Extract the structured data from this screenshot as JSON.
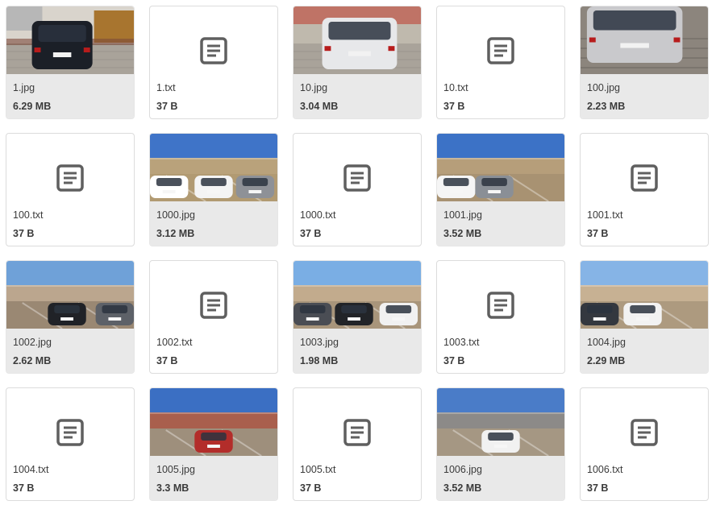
{
  "files": [
    {
      "name": "1.jpg",
      "size": "6.29 MB",
      "type": "image",
      "icon": "car-photo"
    },
    {
      "name": "1.txt",
      "size": "37 B",
      "type": "text",
      "icon": "text-file-icon"
    },
    {
      "name": "10.jpg",
      "size": "3.04 MB",
      "type": "image",
      "icon": "car-photo"
    },
    {
      "name": "10.txt",
      "size": "37 B",
      "type": "text",
      "icon": "text-file-icon"
    },
    {
      "name": "100.jpg",
      "size": "2.23 MB",
      "type": "image",
      "icon": "car-photo"
    },
    {
      "name": "100.txt",
      "size": "37 B",
      "type": "text",
      "icon": "text-file-icon"
    },
    {
      "name": "1000.jpg",
      "size": "3.12 MB",
      "type": "image",
      "icon": "parking-lot-photo"
    },
    {
      "name": "1000.txt",
      "size": "37 B",
      "type": "text",
      "icon": "text-file-icon"
    },
    {
      "name": "1001.jpg",
      "size": "3.52 MB",
      "type": "image",
      "icon": "parking-lot-photo"
    },
    {
      "name": "1001.txt",
      "size": "37 B",
      "type": "text",
      "icon": "text-file-icon"
    },
    {
      "name": "1002.jpg",
      "size": "2.62 MB",
      "type": "image",
      "icon": "parking-lot-photo"
    },
    {
      "name": "1002.txt",
      "size": "37 B",
      "type": "text",
      "icon": "text-file-icon"
    },
    {
      "name": "1003.jpg",
      "size": "1.98 MB",
      "type": "image",
      "icon": "parking-lot-photo"
    },
    {
      "name": "1003.txt",
      "size": "37 B",
      "type": "text",
      "icon": "text-file-icon"
    },
    {
      "name": "1004.jpg",
      "size": "2.29 MB",
      "type": "image",
      "icon": "parking-lot-photo"
    },
    {
      "name": "1004.txt",
      "size": "37 B",
      "type": "text",
      "icon": "text-file-icon"
    },
    {
      "name": "1005.jpg",
      "size": "3.3 MB",
      "type": "image",
      "icon": "parking-lot-photo"
    },
    {
      "name": "1005.txt",
      "size": "37 B",
      "type": "text",
      "icon": "text-file-icon"
    },
    {
      "name": "1006.jpg",
      "size": "3.52 MB",
      "type": "image",
      "icon": "parking-lot-photo"
    },
    {
      "name": "1006.txt",
      "size": "37 B",
      "type": "text",
      "icon": "text-file-icon"
    }
  ],
  "colors": {
    "icon": "#5f5f5f",
    "border": "#dcdcdc",
    "sky": "#3f74c8",
    "text": "#3b3b3b"
  }
}
